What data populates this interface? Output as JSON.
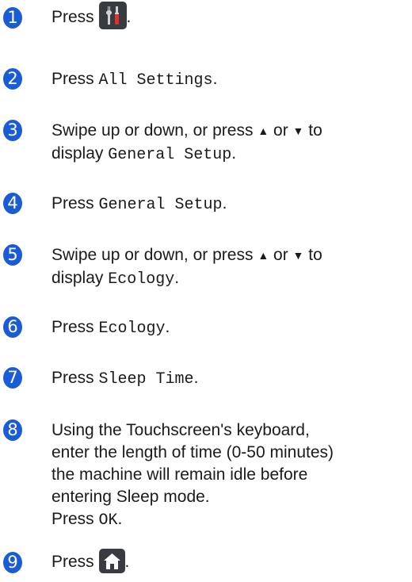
{
  "steps": [
    {
      "num": "1",
      "press": "Press",
      "tail": "."
    },
    {
      "num": "2",
      "press": "Press",
      "code": "All Settings",
      "tail": "."
    },
    {
      "num": "3",
      "a": "Swipe up or down, or press",
      "up": "▲",
      "or": "or",
      "down": "▼",
      "to": "to",
      "b": "display",
      "code": "General Setup",
      "tail": "."
    },
    {
      "num": "4",
      "press": "Press",
      "code": "General Setup",
      "tail": "."
    },
    {
      "num": "5",
      "a": "Swipe up or down, or press",
      "up": "▲",
      "or": "or",
      "down": "▼",
      "to": "to",
      "b": "display",
      "code": "Ecology",
      "tail": "."
    },
    {
      "num": "6",
      "press": "Press",
      "code": "Ecology",
      "tail": "."
    },
    {
      "num": "7",
      "press": "Press",
      "code": "Sleep Time",
      "tail": "."
    },
    {
      "num": "8",
      "lines": [
        "Using the Touchscreen's keyboard,",
        "enter the length of time (0-50 minutes)",
        "the machine will remain idle before",
        "entering Sleep mode."
      ],
      "press": "Press",
      "code": "OK",
      "tail": "."
    },
    {
      "num": "9",
      "press": "Press",
      "tail": "."
    }
  ],
  "icons": {
    "step1": "settings-tools-icon",
    "step9": "home-icon",
    "accent": "#1a5bd6"
  }
}
